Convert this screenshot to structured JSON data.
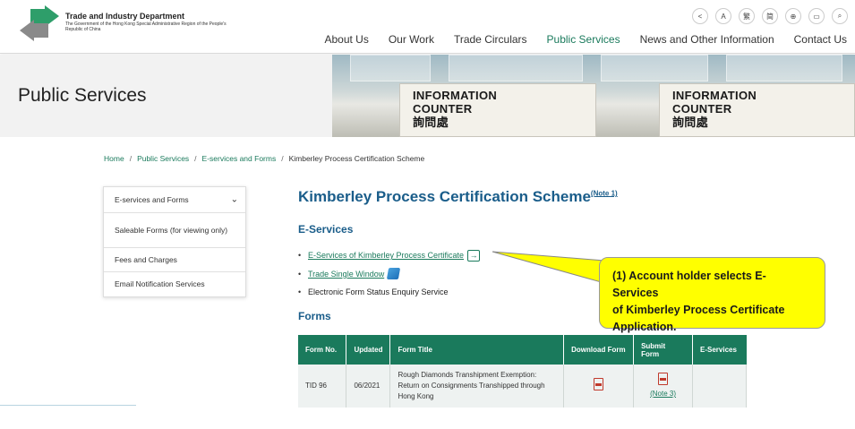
{
  "header": {
    "org_title": "Trade and Industry Department",
    "org_subtitle": "The Government of the Hong Kong Special Administrative Region of the People's Republic of China",
    "top_icons": [
      {
        "name": "share-icon",
        "glyph": "<"
      },
      {
        "name": "font-size-icon",
        "glyph": "A"
      },
      {
        "name": "traditional-chinese-icon",
        "glyph": "繁"
      },
      {
        "name": "simplified-chinese-icon",
        "glyph": "简"
      },
      {
        "name": "globe-icon",
        "glyph": "⊕"
      },
      {
        "name": "print-icon",
        "glyph": "▭"
      },
      {
        "name": "search-icon",
        "glyph": "⌕"
      }
    ],
    "nav": [
      {
        "label": "About Us",
        "active": false
      },
      {
        "label": "Our Work",
        "active": false
      },
      {
        "label": "Trade Circulars",
        "active": false
      },
      {
        "label": "Public Services",
        "active": true
      },
      {
        "label": "News and Other Information",
        "active": false
      },
      {
        "label": "Contact Us",
        "active": false
      }
    ]
  },
  "hero": {
    "title": "Public Services",
    "counter_line1": "INFORMATION",
    "counter_line2": "COUNTER",
    "counter_line3": "詢問處"
  },
  "breadcrumb": {
    "home": "Home",
    "public_services": "Public Services",
    "eservices": "E-services and Forms",
    "current": "Kimberley Process Certification Scheme",
    "separator": "/"
  },
  "sidebar": {
    "items": [
      {
        "label": "E-services and Forms"
      },
      {
        "label": "Saleable Forms (for viewing only)"
      },
      {
        "label": "Fees and Charges"
      },
      {
        "label": "Email Notification Services"
      }
    ]
  },
  "main": {
    "title": "Kimberley Process Certification Scheme",
    "title_note": "(Note 1)",
    "eservices_heading": "E-Services",
    "eservice_links": {
      "kimberley": "E-Services of Kimberley Process Certificate",
      "tsw": "Trade Single Window",
      "status": "Electronic Form Status Enquiry Service"
    },
    "forms_heading": "Forms",
    "table": {
      "headers": [
        "Form No.",
        "Updated",
        "Form Title",
        "Download Form",
        "Submit Form",
        "E-Services"
      ],
      "rows": [
        {
          "form_no": "TID 96",
          "updated": "06/2021",
          "title": "Rough Diamonds Transhipment Exemption: Return on Consignments Transhipped through Hong Kong",
          "submit_note": "(Note 3)"
        }
      ]
    }
  },
  "callout": {
    "line1": "(1) Account holder selects E-Services",
    "line2": "of Kimberley Process Certificate",
    "line3": "Application."
  },
  "colors": {
    "brand_green": "#1a7a5c",
    "heading_blue": "#1a5d8a",
    "callout_yellow": "#ffff00"
  }
}
